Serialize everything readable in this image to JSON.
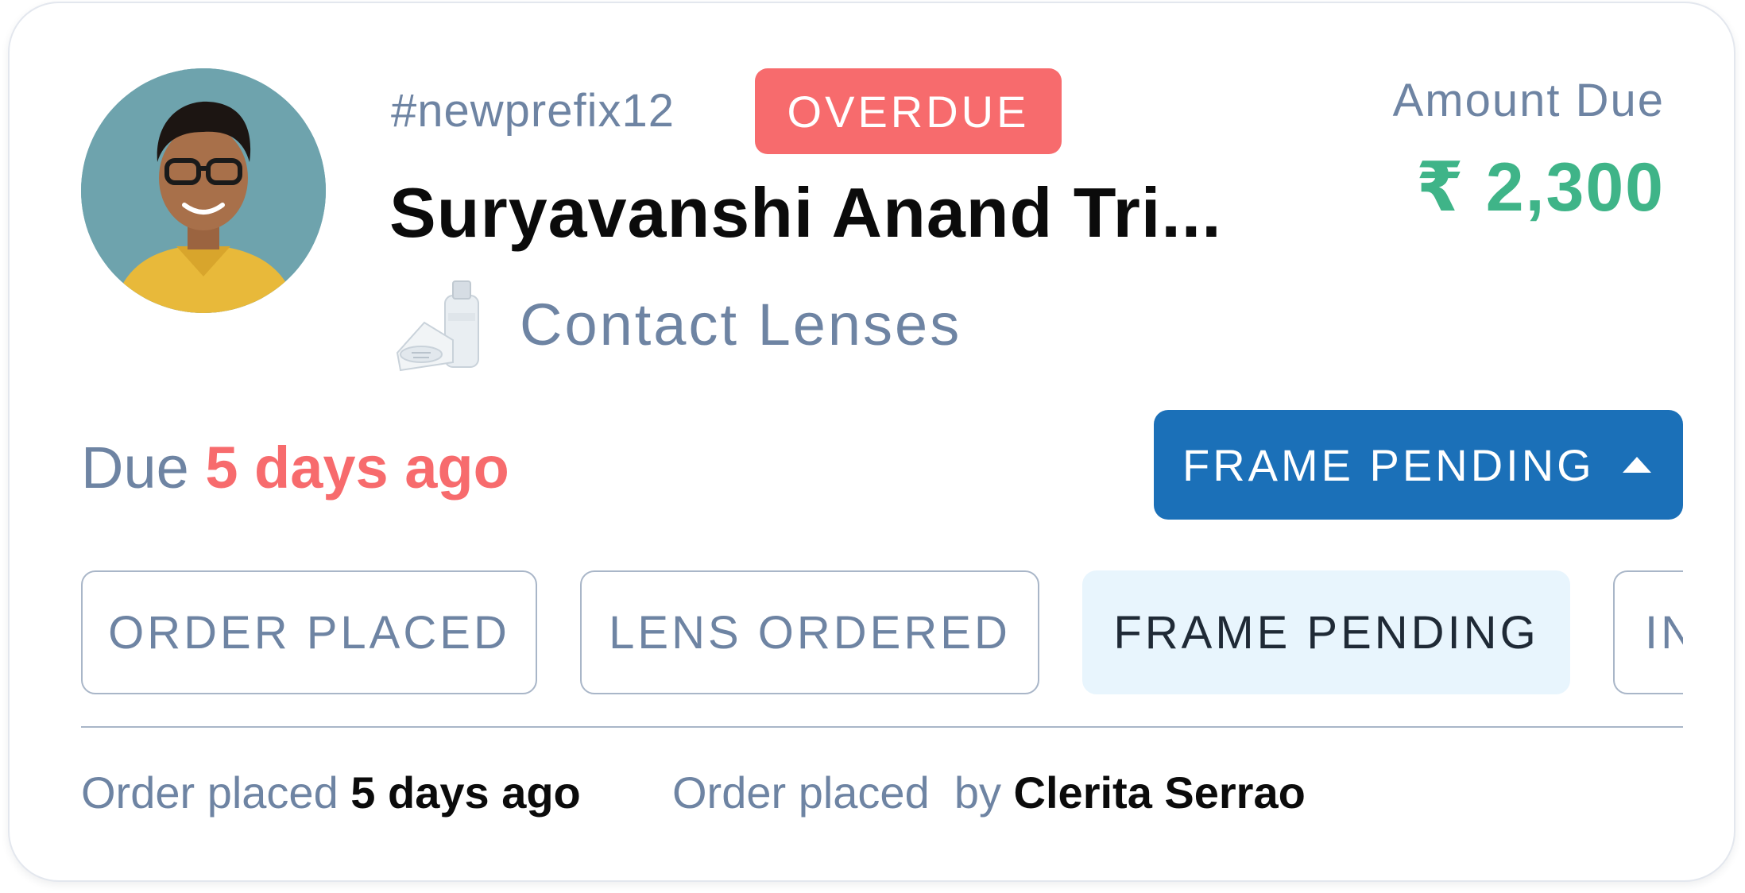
{
  "colors": {
    "muted": "#6e84a3",
    "overdue": "#f76b6d",
    "amount": "#3fb488",
    "primary": "#1b70b8",
    "active_step_bg": "#e8f5fd",
    "dark": "#0b0b0b"
  },
  "order": {
    "id": "#newprefix12",
    "overdue_badge": "OVERDUE",
    "customer_name": "Suryavanshi Anand Tri...",
    "product_icon": "contact-lens-case-icon",
    "product_label": "Contact Lenses"
  },
  "amount": {
    "label": "Amount Due",
    "value": "₹ 2,300"
  },
  "due": {
    "prefix": "Due",
    "when": "5 days ago"
  },
  "status_dropdown": {
    "label": "FRAME PENDING",
    "icon": "caret-up-icon"
  },
  "steps": [
    {
      "label": "ORDER PLACED",
      "active": false
    },
    {
      "label": "LENS ORDERED",
      "active": false
    },
    {
      "label": "FRAME PENDING",
      "active": true
    },
    {
      "label": "IN",
      "active": false
    }
  ],
  "footer": {
    "placed_label": "Order placed",
    "placed_when": "5 days ago",
    "placed_by_label": "Order placed  by",
    "placed_by_name": "Clerita Serrao"
  }
}
